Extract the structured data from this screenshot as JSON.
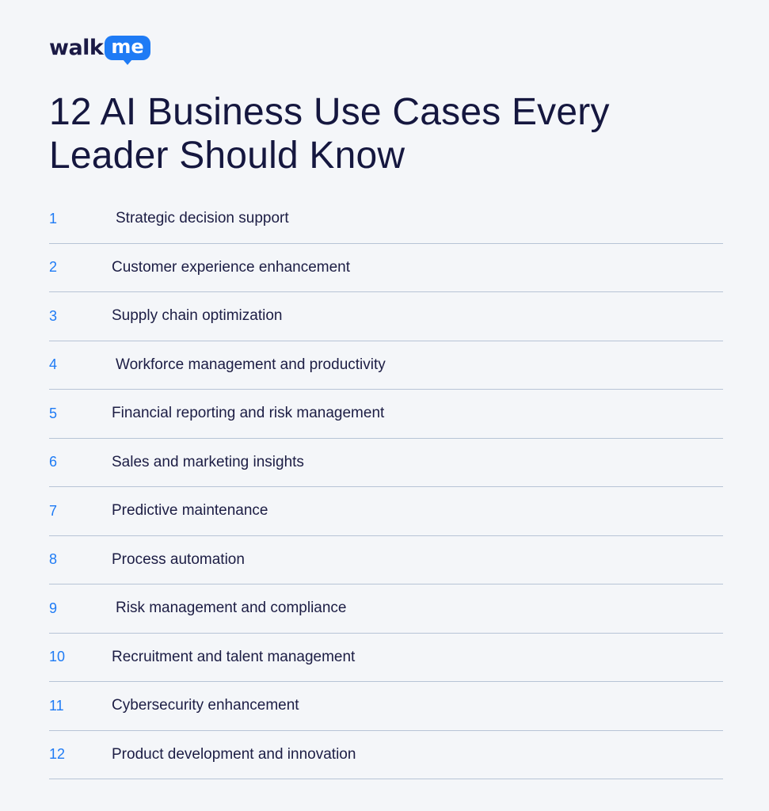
{
  "brand": {
    "logo_part1": "walk",
    "logo_part2": "me",
    "accent_color": "#1e7bf5",
    "text_color": "#15173f"
  },
  "title": "12 AI Business Use Cases Every Leader Should Know",
  "items": [
    {
      "num": "1",
      "label": "Strategic decision support"
    },
    {
      "num": "2",
      "label": "Customer experience enhancement"
    },
    {
      "num": "3",
      "label": "Supply chain optimization"
    },
    {
      "num": "4",
      "label": "Workforce management and productivity"
    },
    {
      "num": "5",
      "label": "Financial reporting and risk management"
    },
    {
      "num": "6",
      "label": "Sales and marketing insights"
    },
    {
      "num": "7",
      "label": "Predictive maintenance"
    },
    {
      "num": "8",
      "label": "Process automation"
    },
    {
      "num": "9",
      "label": "Risk management and compliance"
    },
    {
      "num": "10",
      "label": "Recruitment and talent management"
    },
    {
      "num": "11",
      "label": "Cybersecurity enhancement"
    },
    {
      "num": "12",
      "label": "Product development and innovation"
    }
  ]
}
